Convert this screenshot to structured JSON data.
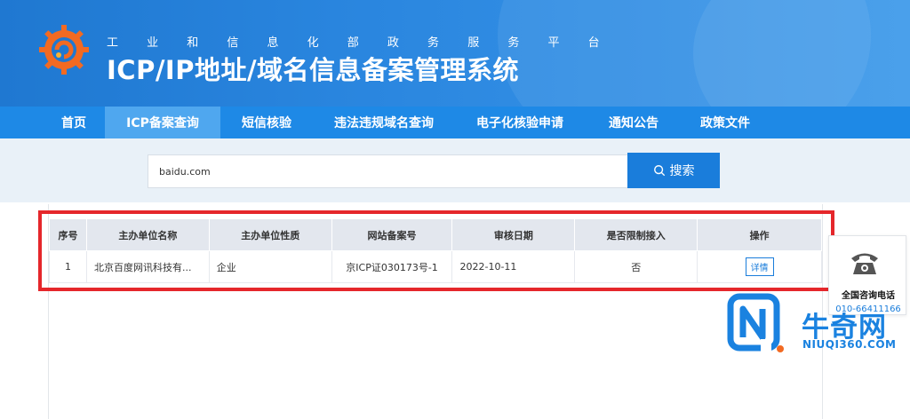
{
  "header": {
    "org_title": "工 业 和 信 息 化 部 政 务 服 务 平 台",
    "system_title": "ICP/IP地址/域名信息备案管理系统"
  },
  "nav": {
    "items": [
      {
        "label": "首页"
      },
      {
        "label": "ICP备案查询"
      },
      {
        "label": "短信核验"
      },
      {
        "label": "违法违规域名查询"
      },
      {
        "label": "电子化核验申请"
      },
      {
        "label": "通知公告"
      },
      {
        "label": "政策文件"
      }
    ],
    "active_index": 1
  },
  "search": {
    "value": "baidu.com",
    "button_label": "搜索"
  },
  "table": {
    "headers": [
      "序号",
      "主办单位名称",
      "主办单位性质",
      "网站备案号",
      "审核日期",
      "是否限制接入",
      "操作"
    ],
    "rows": [
      {
        "index": "1",
        "org_name": "北京百度网讯科技有...",
        "org_type": "企业",
        "record_no": "京ICP证030173号-1",
        "audit_date": "2022-10-11",
        "restricted": "否",
        "action": "详情"
      }
    ]
  },
  "side_widget": {
    "label": "全国咨询电话",
    "number": "010-66411166",
    "icon": "phone-icon"
  },
  "watermark": {
    "brand": "牛奇网",
    "url": "NIUQI360.COM"
  },
  "colors": {
    "primary": "#1e89e6",
    "nav_active": "#4fa7ef",
    "highlight_red": "#e5272b",
    "search_band": "#e9f1f8"
  }
}
